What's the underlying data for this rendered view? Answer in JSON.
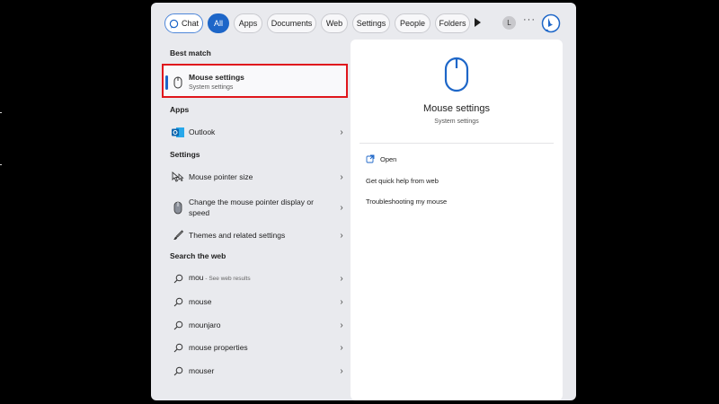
{
  "filters": {
    "chat": "Chat",
    "all": "All",
    "apps": "Apps",
    "documents": "Documents",
    "web": "Web",
    "settings": "Settings",
    "people": "People",
    "folders": "Folders",
    "avatar_initial": "L",
    "more": "···"
  },
  "best_match": {
    "heading": "Best match",
    "title": "Mouse settings",
    "subtitle": "System settings"
  },
  "apps": {
    "heading": "Apps",
    "items": [
      {
        "label": "Outlook"
      }
    ]
  },
  "settings": {
    "heading": "Settings",
    "items": [
      {
        "label": "Mouse pointer size"
      },
      {
        "label": "Change the mouse pointer display or speed"
      },
      {
        "label": "Themes and related settings"
      }
    ]
  },
  "web": {
    "heading": "Search the web",
    "items": [
      {
        "label": "mou",
        "hint": " - See web results"
      },
      {
        "label": "mouse"
      },
      {
        "label": "mounjaro"
      },
      {
        "label": "mouse properties"
      },
      {
        "label": "mouser"
      }
    ]
  },
  "preview": {
    "title": "Mouse settings",
    "subtitle": "System settings",
    "actions": {
      "open": "Open",
      "quick_help": "Get quick help from web",
      "troubleshoot": "Troubleshooting my mouse"
    }
  },
  "colors": {
    "accent": "#1d66c8",
    "highlight": "#e0161c",
    "panel": "#e9eaee"
  }
}
